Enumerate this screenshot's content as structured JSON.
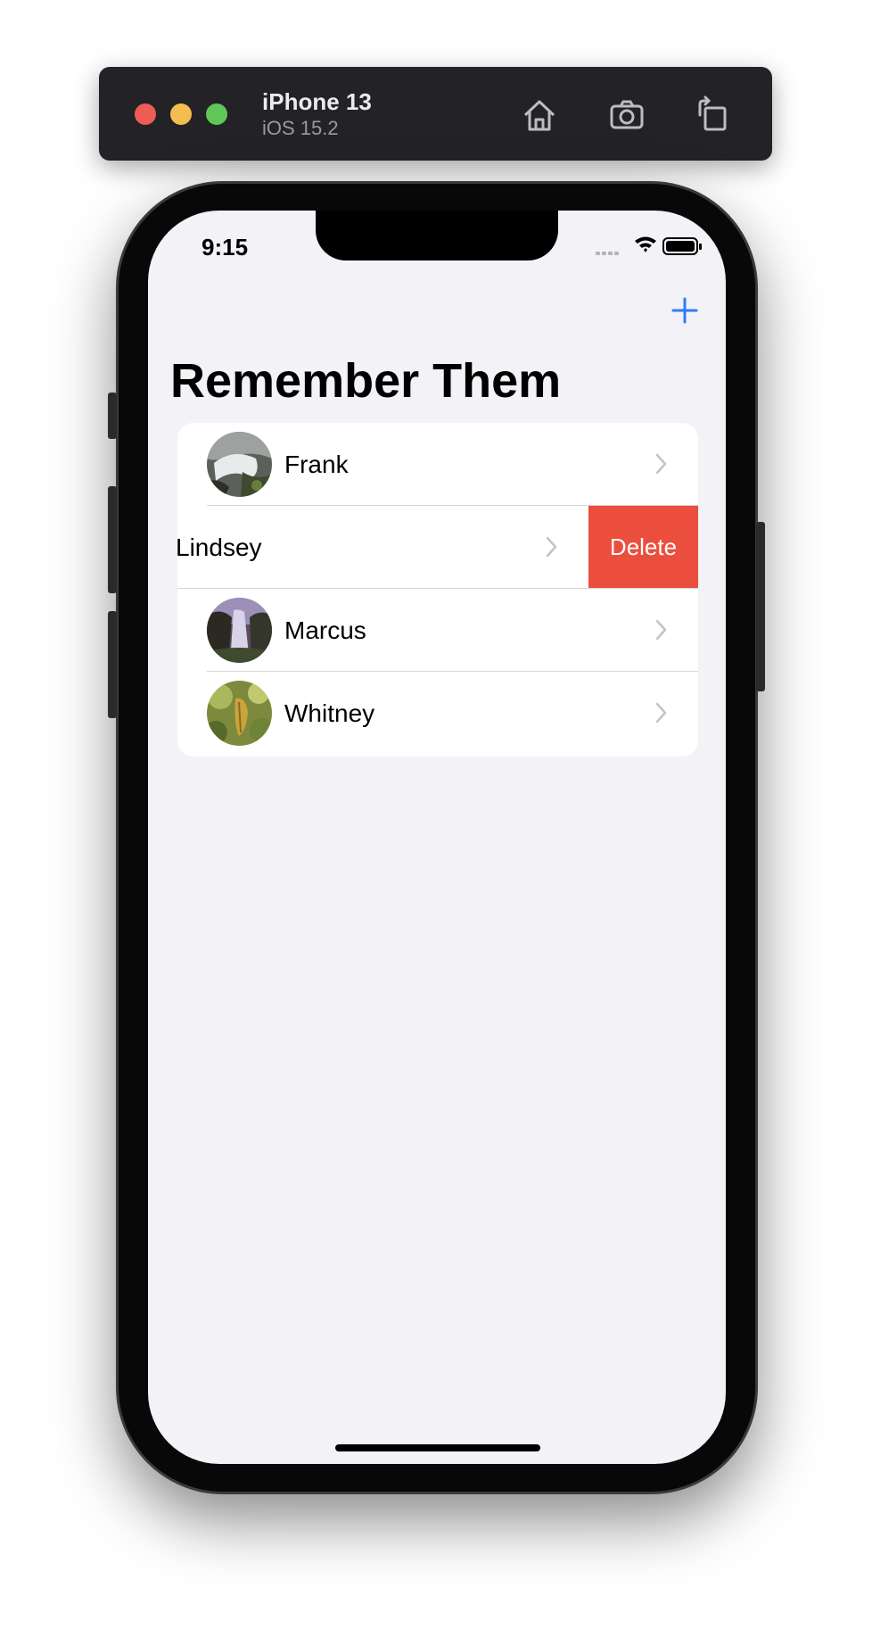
{
  "simulator": {
    "device_name": "iPhone 13",
    "os_version": "iOS 15.2",
    "icons": [
      "home-icon",
      "screenshot-icon",
      "rotate-icon"
    ]
  },
  "status_bar": {
    "time": "9:15",
    "icons": [
      "cellular-icon",
      "wifi-icon",
      "battery-icon"
    ]
  },
  "nav": {
    "title": "Remember Them",
    "add_icon": "plus-icon",
    "accent_color": "#2f7cf6"
  },
  "people": [
    {
      "name": "Frank",
      "photo": "waterfall-rocks"
    },
    {
      "name": "Lindsey",
      "photo": "",
      "swiped": true
    },
    {
      "name": "Marcus",
      "photo": "waterfall-cliff"
    },
    {
      "name": "Whitney",
      "photo": "green-leaves"
    }
  ],
  "swipe_action": {
    "label": "Delete",
    "color": "#eb4e3d"
  }
}
